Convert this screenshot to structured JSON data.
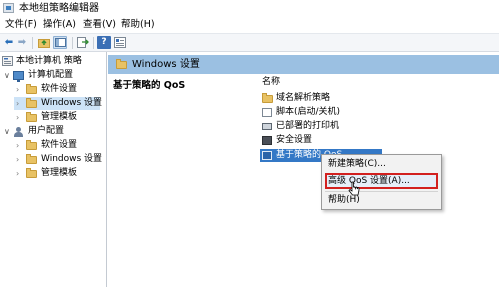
{
  "window": {
    "title": "本地组策略编辑器"
  },
  "menubar": {
    "items": [
      "文件(F)",
      "操作(A)",
      "查看(V)",
      "帮助(H)"
    ]
  },
  "toolbar": {
    "icons": [
      "back-arrow-icon",
      "forward-arrow-icon",
      "up-folder-icon",
      "show-tree-icon",
      "export-icon",
      "help-icon",
      "properties-icon"
    ]
  },
  "tree": {
    "root": "本地计算机 策略",
    "computer_config": "计算机配置",
    "computer_children": [
      "软件设置",
      "Windows 设置",
      "管理模板"
    ],
    "user_config": "用户配置",
    "user_children": [
      "软件设置",
      "Windows 设置",
      "管理模板"
    ]
  },
  "path_band": {
    "label": "Windows 设置"
  },
  "detail": {
    "heading": "基于策略的 QoS"
  },
  "list": {
    "column_header": "名称",
    "items": [
      "域名解析策略",
      "脚本(启动/关机)",
      "已部署的打印机",
      "安全设置",
      "基于策略的 QoS"
    ]
  },
  "context_menu": {
    "items": [
      "新建策略(C)...",
      "高级 QoS 设置(A)...",
      "帮助(H)"
    ]
  },
  "colors": {
    "selection": "#cde3f7",
    "path_band": "#9bc0e2",
    "highlight_border": "#d2201f",
    "list_selection": "#3478c6"
  }
}
